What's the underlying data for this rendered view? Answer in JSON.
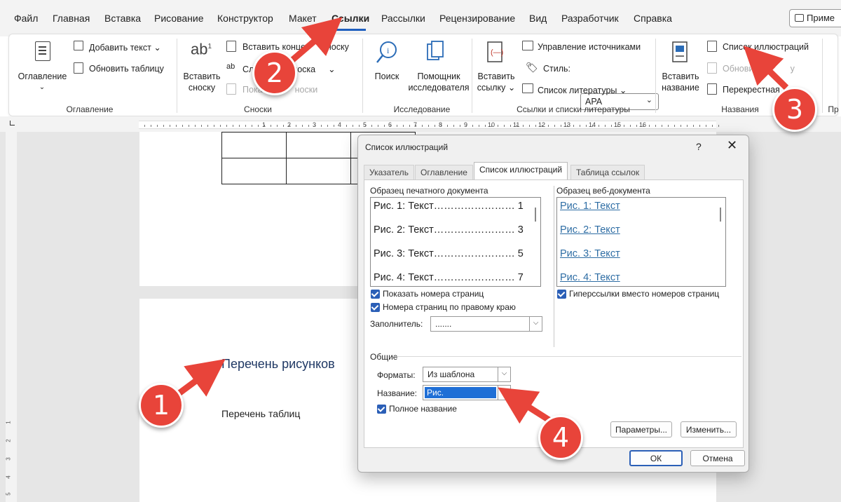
{
  "tabs": [
    "Файл",
    "Главная",
    "Вставка",
    "Рисование",
    "Конструктор",
    "Макет",
    "Ссылки",
    "Рассылки",
    "Рецензирование",
    "Вид",
    "Разработчик",
    "Справка"
  ],
  "active_tab": "Ссылки",
  "share_button": "Приме",
  "ribbon": {
    "toc": {
      "big_button": "Оглавление",
      "add_text": "Добавить текст",
      "update_table": "Обновить таблицу",
      "group": "Оглавление"
    },
    "footnotes": {
      "insert_big_line1": "Вставить",
      "insert_big_line2": "сноску",
      "insert_endnote": "Вставить конце",
      "insert_endnote_tail": "носку",
      "next_footnote": "Сл",
      "next_footnote_tail": "носка",
      "show_notes": "Пока",
      "show_notes_tail": "носки",
      "group": "Сноски"
    },
    "research": {
      "search": "Поиск",
      "helper_line1": "Помощник",
      "helper_line2": "исследователя",
      "group": "Исследование"
    },
    "citations": {
      "insert_line1": "Вставить",
      "insert_line2": "ссылку",
      "manage_sources": "Управление источниками",
      "style_label": "Стиль:",
      "style_value": "APA",
      "bibliography": "Список литературы",
      "group": "Ссылки и списки литературы"
    },
    "captions": {
      "insert_line1": "Вставить",
      "insert_line2": "название",
      "list_of_figures": "Список иллюстраций",
      "update_table": "Обновить",
      "update_table_tail": "у",
      "cross_reference": "Перекрестная",
      "group": "Названия"
    },
    "next_group_stub": "Пр"
  },
  "ruler_numbers": [
    "1",
    "2",
    "3",
    "4",
    "5",
    "6",
    "7",
    "8",
    "9",
    "10",
    "11",
    "12",
    "13",
    "14",
    "15",
    "16"
  ],
  "vruler_numbers": [
    "1",
    "2",
    "3",
    "4",
    "5"
  ],
  "document": {
    "heading": "Перечень рисунков",
    "paragraph": "Перечень таблиц"
  },
  "dialog": {
    "title": "Список иллюстраций",
    "help": "?",
    "close": "✕",
    "tabs": [
      "Указатель",
      "Оглавление",
      "Список иллюстраций",
      "Таблица ссылок"
    ],
    "active_tab": "Список иллюстраций",
    "print_preview_label": "Образец печатного документа",
    "print_preview_lines": [
      "Рис. 1: Текст…………………… 1",
      "Рис. 2: Текст…………………… 3",
      "Рис. 3: Текст…………………… 5",
      "Рис. 4: Текст…………………… 7"
    ],
    "web_preview_label": "Образец веб-документа",
    "web_preview_lines": [
      "Рис. 1: Текст",
      "Рис. 2: Текст",
      "Рис. 3: Текст",
      "Рис. 4: Текст"
    ],
    "show_page_numbers": "Показать номера страниц",
    "right_align": "Номера страниц по правому краю",
    "leader_label": "Заполнитель:",
    "leader_value": ".......",
    "hyperlinks": "Гиперссылки вместо номеров страниц",
    "general_label": "Общие",
    "formats_label": "Форматы:",
    "formats_value": "Из шаблона",
    "caption_label": "Название:",
    "caption_value": "Рис.",
    "full_caption": "Полное название",
    "options_button": "Параметры...",
    "modify_button": "Изменить...",
    "ok_button": "ОК",
    "cancel_button": "Отмена"
  },
  "annotations": [
    "1",
    "2",
    "3",
    "4"
  ],
  "colors": {
    "accent": "#1f5fbf",
    "badge": "#e8443a",
    "checkbox": "#2b5fb7",
    "heading": "#1f3864",
    "link": "#2e6da4"
  }
}
